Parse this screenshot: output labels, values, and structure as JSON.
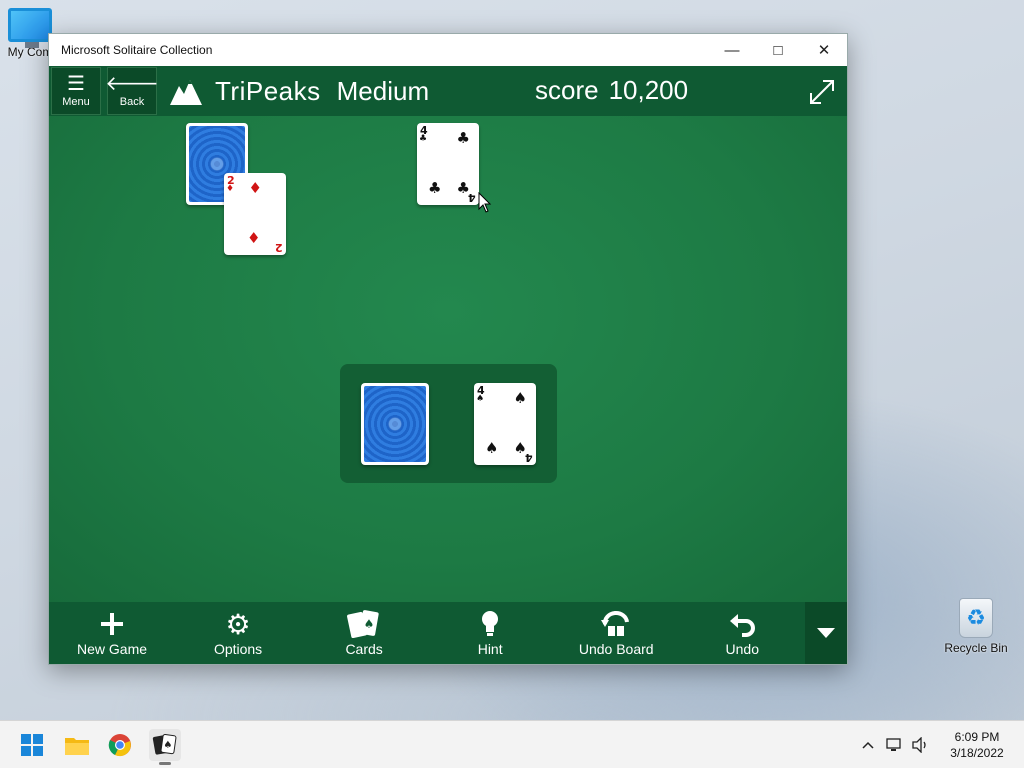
{
  "desktop": {
    "icons": [
      {
        "label": "My Com"
      },
      {
        "label": "Recycle Bin"
      }
    ]
  },
  "window": {
    "title": "Microsoft Solitaire Collection",
    "controls": {
      "minimize": "—",
      "maximize": "□",
      "close": "✕"
    }
  },
  "header": {
    "menu_label": "Menu",
    "back_label": "Back",
    "game_name": "TriPeaks",
    "difficulty": "Medium",
    "score_label": "score",
    "score_value": "10,200"
  },
  "board": {
    "face_down_card": {
      "back_color": "#1e64c8"
    },
    "peak_card_left": {
      "rank": "2",
      "suit": "♦",
      "color": "#d01414"
    },
    "peak_card_right": {
      "rank": "4",
      "suit": "♣",
      "color": "#111111"
    },
    "stock_pile": {
      "back_color": "#1e64c8"
    },
    "waste_card": {
      "rank": "4",
      "suit": "♠",
      "color": "#111111"
    }
  },
  "toolbar": {
    "items": [
      {
        "label": "New Game",
        "icon": "plus-icon"
      },
      {
        "label": "Options",
        "icon": "gear-icon"
      },
      {
        "label": "Cards",
        "icon": "cards-icon"
      },
      {
        "label": "Hint",
        "icon": "lightbulb-icon"
      },
      {
        "label": "Undo Board",
        "icon": "undo-board-icon"
      },
      {
        "label": "Undo",
        "icon": "undo-icon"
      }
    ],
    "more_icon": "chevron-down-icon"
  },
  "taskbar": {
    "apps": [
      "start-icon",
      "file-explorer-icon",
      "chrome-icon",
      "solitaire-icon"
    ],
    "time": "6:09 PM",
    "date": "3/18/2022"
  },
  "colors": {
    "felt": "#1d7a44",
    "header": "#0f5a33",
    "card_red": "#d01414"
  }
}
